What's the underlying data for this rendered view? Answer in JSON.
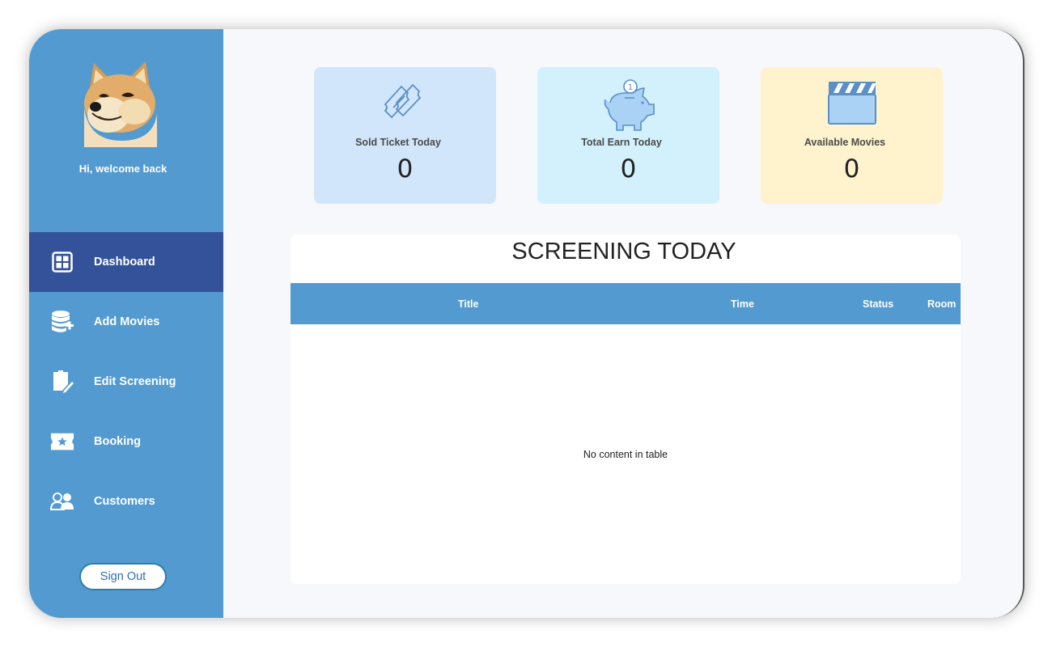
{
  "sidebar": {
    "welcome": "Hi, welcome back",
    "items": [
      {
        "label": "Dashboard",
        "icon": "dashboard-icon",
        "active": true
      },
      {
        "label": "Add Movies",
        "icon": "database-add-icon"
      },
      {
        "label": "Edit Screening",
        "icon": "edit-document-icon"
      },
      {
        "label": "Booking",
        "icon": "ticket-star-icon"
      },
      {
        "label": "Customers",
        "icon": "users-icon"
      }
    ],
    "signout_label": "Sign Out"
  },
  "cards": [
    {
      "label": "Sold Ticket Today",
      "value": "0",
      "icon": "tickets-icon",
      "color": "#d1e6fa"
    },
    {
      "label": "Total Earn Today",
      "value": "0",
      "icon": "piggy-bank-icon",
      "color": "#d2f1fd"
    },
    {
      "label": "Available Movies",
      "value": "0",
      "icon": "clapperboard-icon",
      "color": "#fff3ce"
    }
  ],
  "screening": {
    "title": "SCREENING TODAY",
    "columns": [
      "Title",
      "Time",
      "Status",
      "Room"
    ],
    "empty_message": "No content in table"
  },
  "colors": {
    "sidebar": "#529ad0",
    "active_nav": "#34529a",
    "table_header": "#529ad0"
  }
}
